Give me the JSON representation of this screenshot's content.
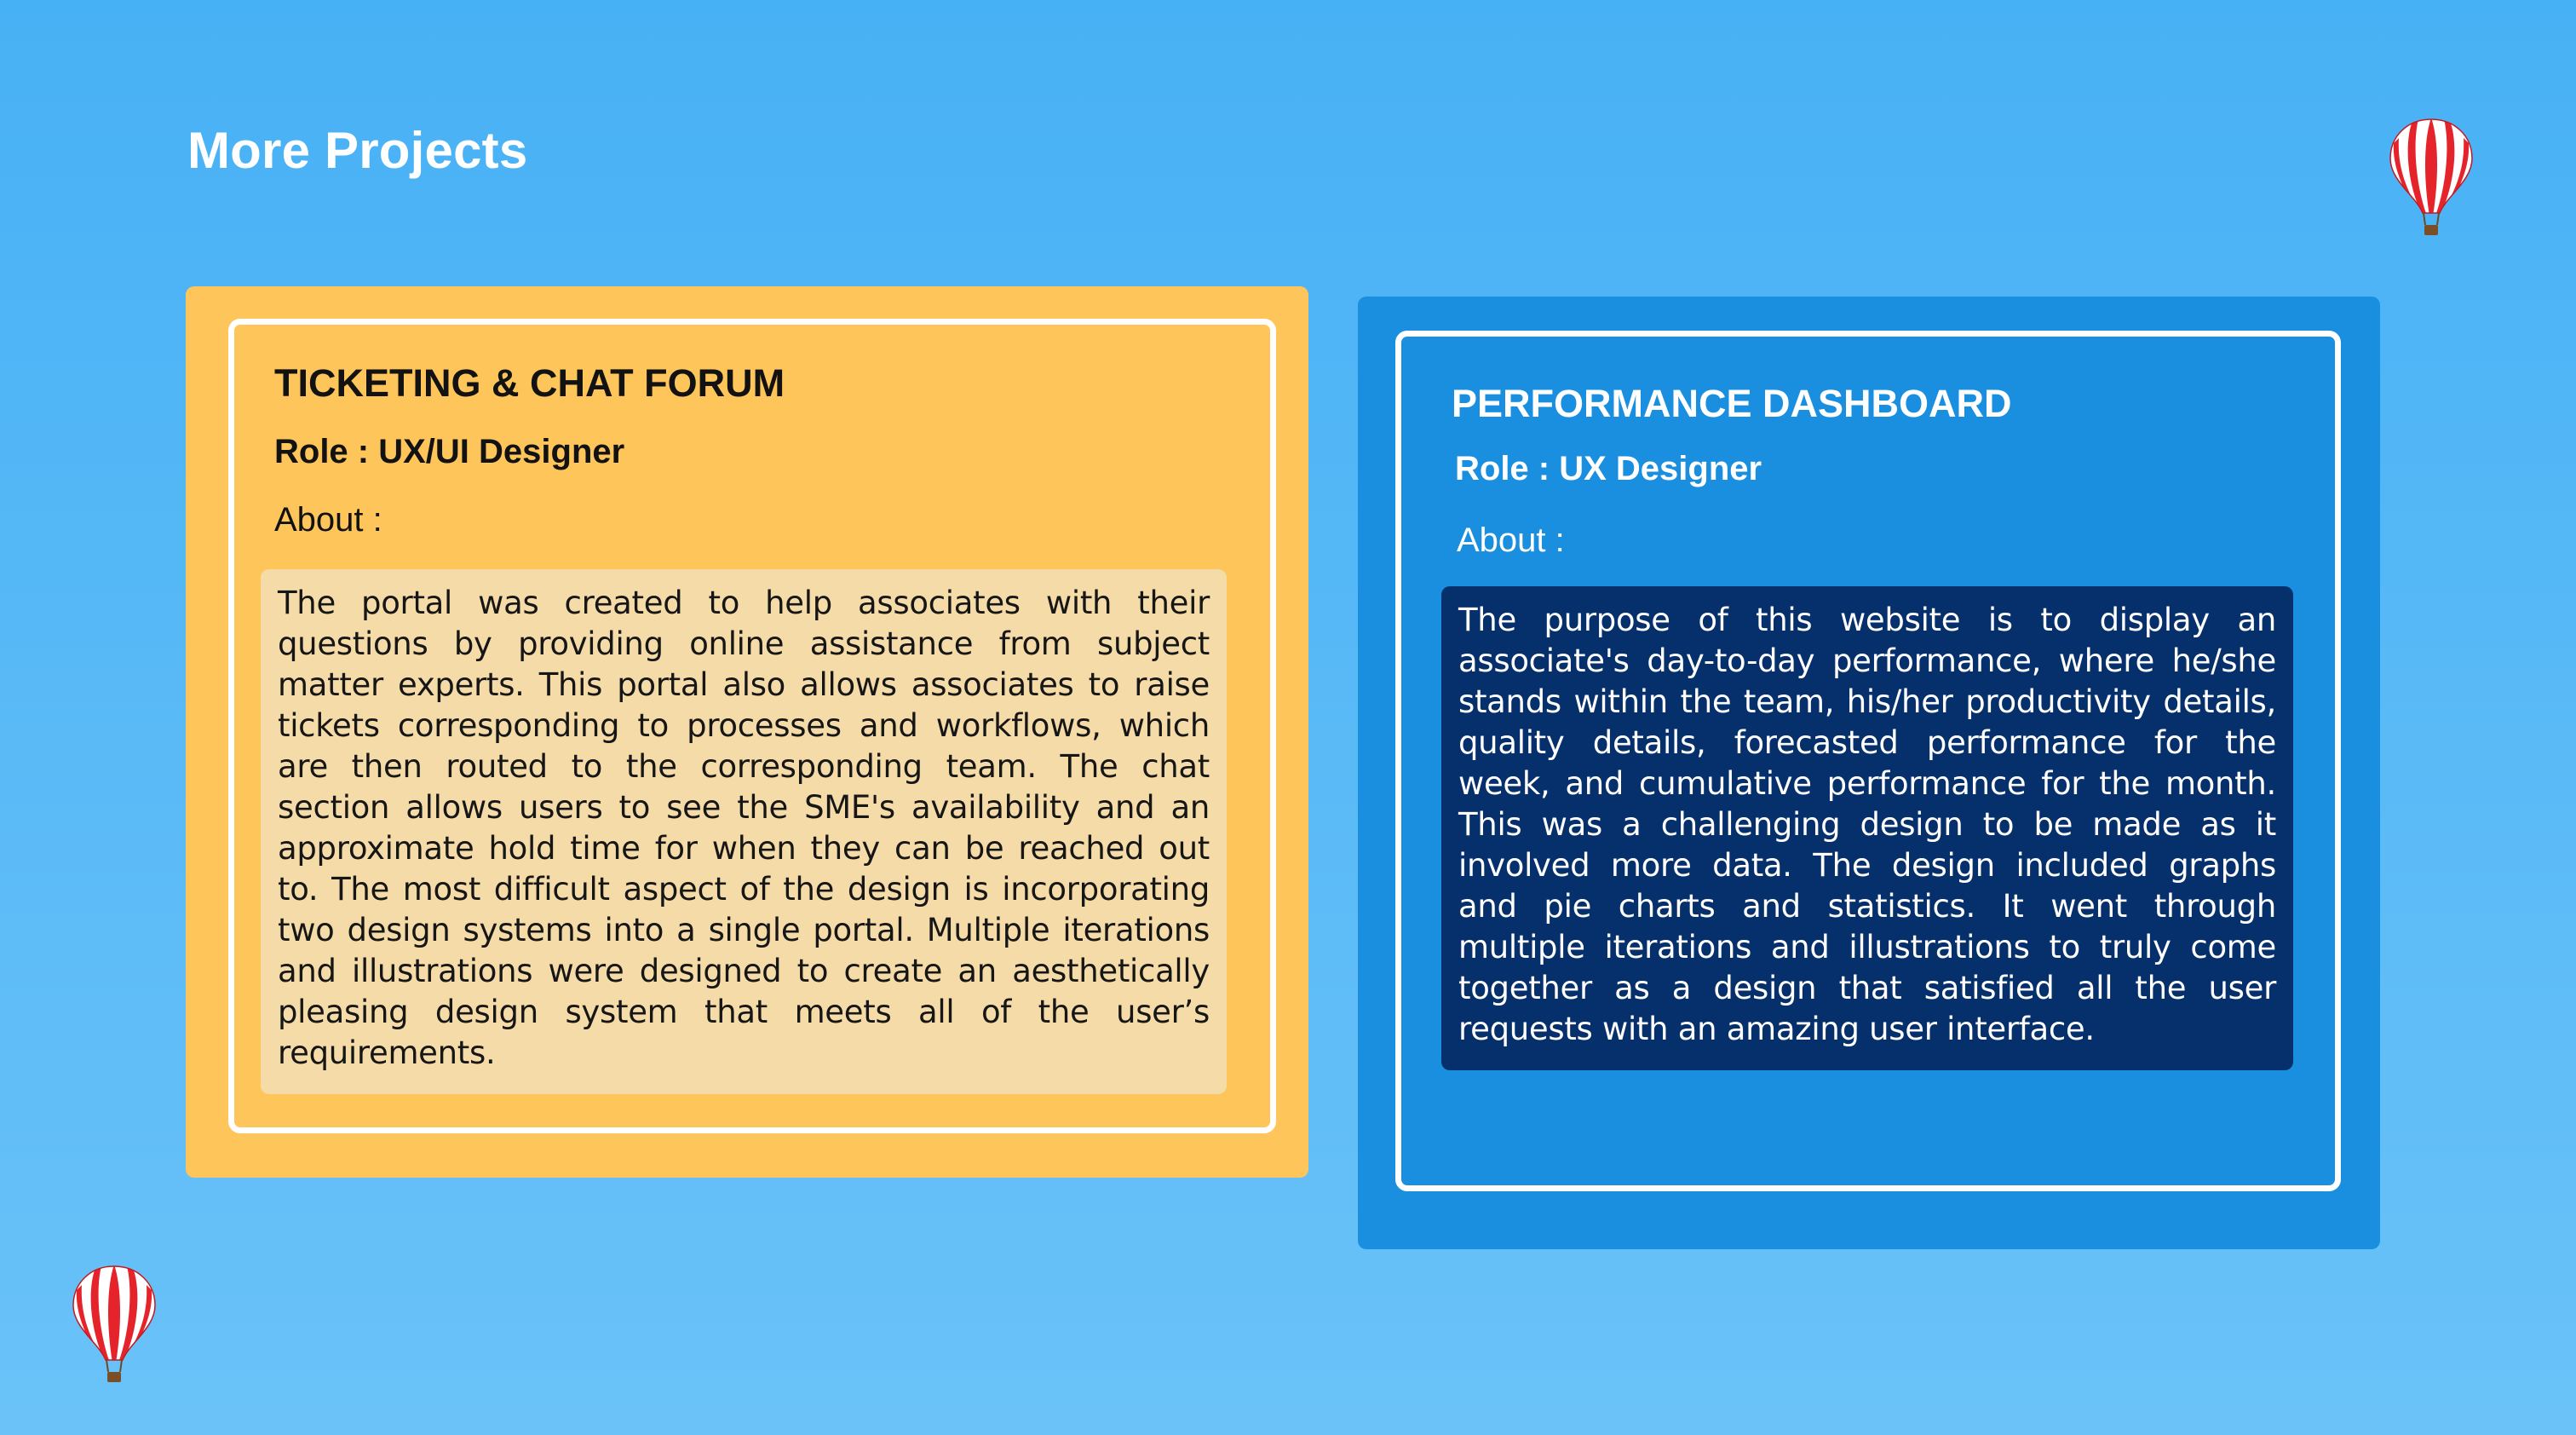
{
  "page": {
    "title": "More Projects"
  },
  "colors": {
    "background": "#47b1f5",
    "yellow_card": "#fec55a",
    "yellow_about": "#f5dba7",
    "blue_card": "#1a8fe0",
    "blue_about": "#05306b",
    "balloon_red": "#e5232b"
  },
  "icons": {
    "top_right": "hot-air-balloon",
    "bottom_left": "hot-air-balloon"
  },
  "projects": [
    {
      "title": "TICKETING & CHAT FORUM",
      "role": "Role : UX/UI Designer",
      "about_label": "About :",
      "about_text": "The portal was created to help associates with their questions by providing online assistance from subject matter experts. This portal also allows associates to raise tickets corresponding to processes and workflows, which are then routed to the corresponding team. The chat section allows users to see the SME's availability and an approximate hold time for when they can be reached out to. The most difficult aspect of the design is incorporating two design systems into a single portal. Multiple iterations and illustrations were designed to create an aesthetically pleasing design system that meets all of the user’s requirements."
    },
    {
      "title": "PERFORMANCE DASHBOARD",
      "role": "Role : UX Designer",
      "about_label": "About :",
      "about_text": "The purpose of this website is to display an associate's day-to-day performance, where he/she stands within the team, his/her productivity details, quality details, forecasted performance for the week, and cumulative performance for the month. This was a challenging design to be made as it involved more data. The design included graphs and pie charts and statistics. It went through multiple iterations and illustrations to truly come together as a design that satisfied all the user requests with an amazing user interface."
    }
  ]
}
